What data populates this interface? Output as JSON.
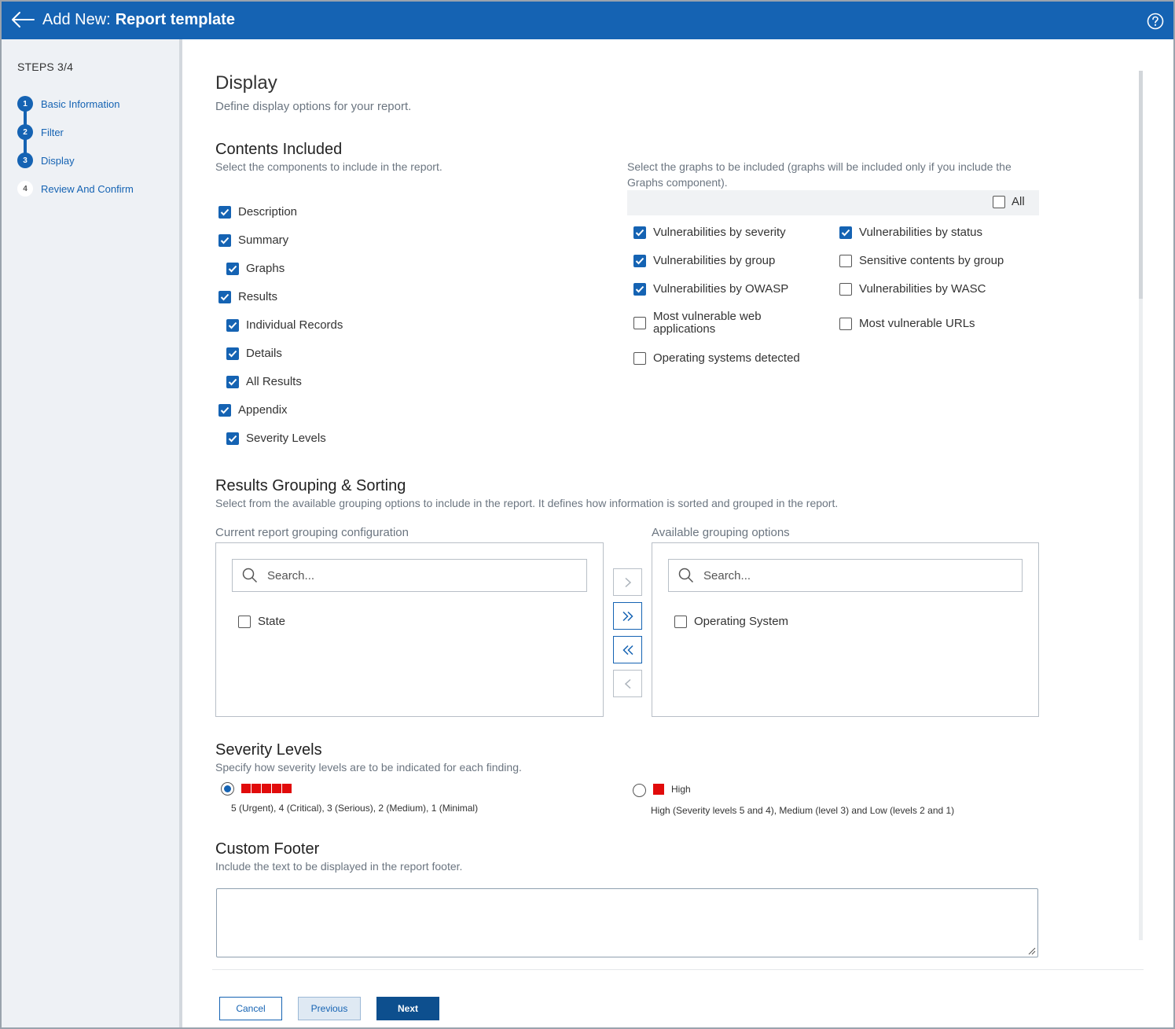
{
  "header": {
    "title_prefix": "Add New:",
    "title_main": "Report template"
  },
  "sidebar": {
    "steps_label": "STEPS 3/4",
    "steps": [
      {
        "num": "1",
        "label": "Basic Information"
      },
      {
        "num": "2",
        "label": "Filter"
      },
      {
        "num": "3",
        "label": "Display"
      },
      {
        "num": "4",
        "label": "Review And Confirm"
      }
    ]
  },
  "page": {
    "title": "Display",
    "subtitle": "Define display options for your report."
  },
  "contents": {
    "title": "Contents Included",
    "desc": "Select the components to include in the report.",
    "items": [
      {
        "label": "Description",
        "checked": true
      },
      {
        "label": "Summary",
        "checked": true
      },
      {
        "label": "Graphs",
        "checked": true
      },
      {
        "label": "Results",
        "checked": true
      },
      {
        "label": "Individual Records",
        "checked": true
      },
      {
        "label": "Details",
        "checked": true
      },
      {
        "label": "All Results",
        "checked": true
      },
      {
        "label": "Appendix",
        "checked": true
      },
      {
        "label": "Severity Levels",
        "checked": true
      }
    ]
  },
  "graphs": {
    "desc_line1": "Select the graphs to be included (graphs will be included only if you include the",
    "desc_line2": "Graphs component).",
    "all_label": "All",
    "left": [
      {
        "label": "Vulnerabilities by severity",
        "checked": true
      },
      {
        "label": "Vulnerabilities by group",
        "checked": true
      },
      {
        "label": "Vulnerabilities by OWASP",
        "checked": true
      },
      {
        "label_line1": "Most vulnerable web",
        "label_line2": "applications",
        "checked": false
      },
      {
        "label": "Operating systems detected",
        "checked": false
      }
    ],
    "right": [
      {
        "label": "Vulnerabilities by status",
        "checked": true
      },
      {
        "label": "Sensitive contents by group",
        "checked": false
      },
      {
        "label": "Vulnerabilities by WASC",
        "checked": false
      },
      {
        "label": "Most vulnerable URLs",
        "checked": false
      }
    ]
  },
  "grouping": {
    "title": "Results Grouping & Sorting",
    "desc": "Select from the available grouping options to include in the report. It defines how information is sorted and grouped in the report.",
    "current_label": "Current report grouping configuration",
    "available_label": "Available grouping options",
    "search_placeholder": "Search...",
    "current_items": [
      "State"
    ],
    "available_items": [
      "Operating System"
    ]
  },
  "severity": {
    "title": "Severity Levels",
    "desc": "Specify how severity levels are to be indicated for each finding.",
    "option1_desc": "5 (Urgent), 4 (Critical), 3 (Serious), 2 (Medium), 1 (Minimal)",
    "option2_label": "High",
    "option2_desc": "High (Severity levels 5 and 4), Medium (level 3) and Low (levels 2 and 1)",
    "selected": 1,
    "color": "#e10b0b"
  },
  "footer": {
    "title": "Custom Footer",
    "desc": "Include the text to be displayed in the report footer.",
    "value": ""
  },
  "buttons": {
    "cancel": "Cancel",
    "previous": "Previous",
    "next": "Next"
  },
  "colors": {
    "primary": "#1563b3",
    "danger": "#e10b0b"
  }
}
